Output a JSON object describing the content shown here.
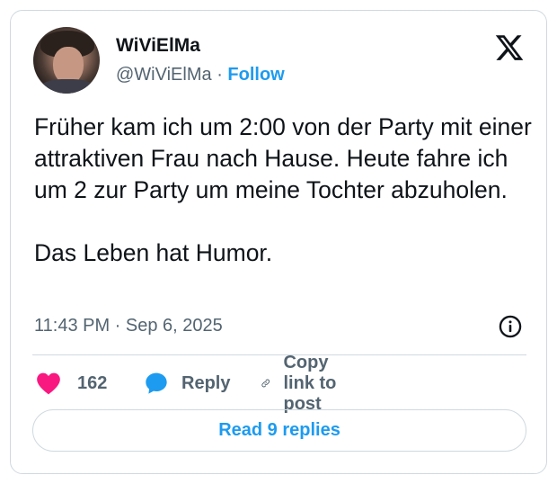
{
  "author": {
    "display_name": "WiViElMa",
    "handle": "@WiViElMa",
    "separator": "·",
    "follow_label": "Follow"
  },
  "tweet": {
    "paragraphs": [
      "Früher kam ich um 2:00 von der Party mit einer attraktiven Frau nach Hause. Heute fahre ich um 2 zur Party um meine Tochter abzuholen.",
      "Das Leben hat Humor."
    ],
    "timestamp": "11:43 PM · Sep 6, 2025"
  },
  "actions": {
    "like_count": "162",
    "reply_label": "Reply",
    "copy_link_label": "Copy link to post"
  },
  "read_replies_label": "Read 9 replies",
  "icons": {
    "logo": "x-logo-icon",
    "info": "info-icon",
    "like": "heart-icon",
    "reply": "speech-bubble-icon",
    "copy": "link-icon"
  },
  "colors": {
    "accent": "#1d9bf0",
    "like": "#f91880",
    "muted": "#536471",
    "text": "#0f1419",
    "border": "#cfd9de"
  }
}
